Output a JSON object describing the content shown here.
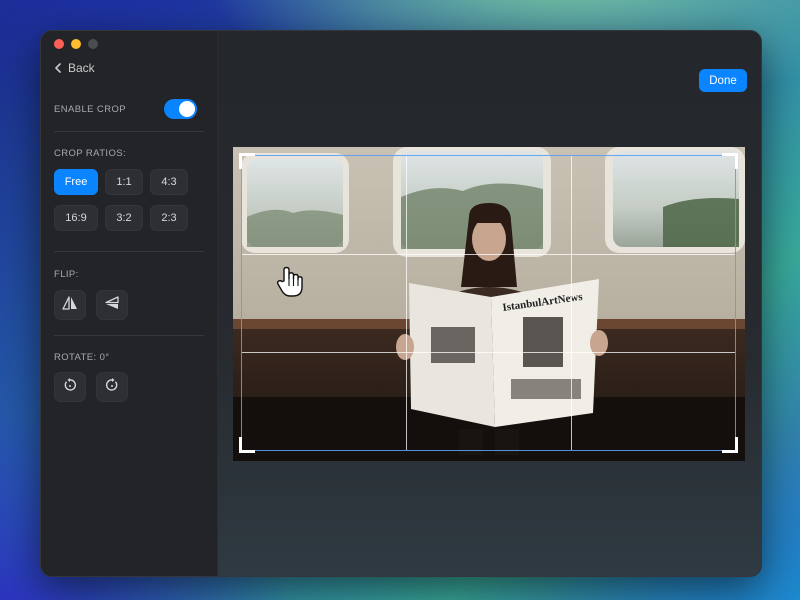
{
  "window": {
    "back_label": "Back",
    "done_label": "Done"
  },
  "sidebar": {
    "enable_crop": {
      "label": "ENABLE CROP",
      "on": true
    },
    "crop_ratios": {
      "label": "CROP RATIOS:",
      "options": [
        "Free",
        "1:1",
        "4:3",
        "16:9",
        "3:2",
        "2:3"
      ],
      "selected": "Free"
    },
    "flip": {
      "label": "FLIP:",
      "buttons": [
        "flip-horizontal-icon",
        "flip-vertical-icon"
      ]
    },
    "rotate": {
      "label": "ROTATE: 0°",
      "buttons": [
        "rotate-left-icon",
        "rotate-right-icon"
      ]
    }
  },
  "canvas": {
    "image": "photo",
    "newspaper_text": "IstanbulArtNews",
    "grid": "rule-of-thirds"
  },
  "colors": {
    "accent": "#0a84ff",
    "crop_border": "#55a0f5",
    "sidebar_bg": "#232427",
    "canvas_bg": "#24272b"
  }
}
